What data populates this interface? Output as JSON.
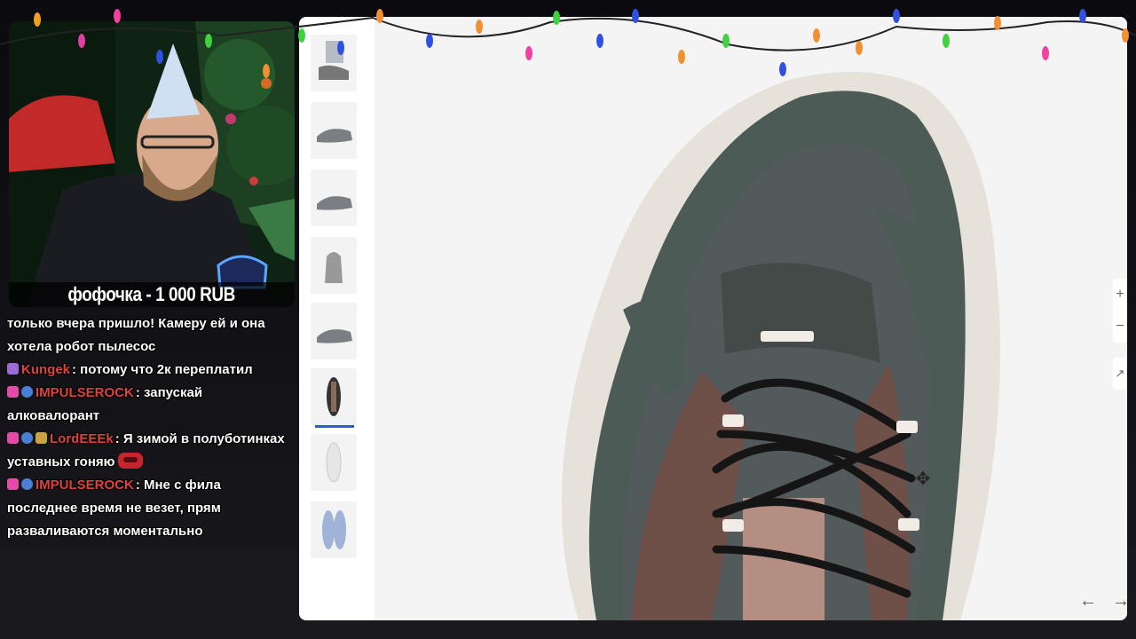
{
  "webcam": {
    "donation": "фофочка - 1 000 RUB"
  },
  "chat": {
    "messages": [
      {
        "user": "",
        "user_color": "#ffffff",
        "text": "только вчера пришло! Камеру ей и она хотела робот пылесос",
        "badges": []
      },
      {
        "user": "Kungek",
        "user_color": "#e0423b",
        "text": ": потому что 2к переплатил",
        "badges": [
          "purple"
        ]
      },
      {
        "user": "IMPULSEROCK",
        "user_color": "#e0423b",
        "text": ": запускай алковалорант",
        "badges": [
          "pink",
          "blue"
        ]
      },
      {
        "user": "LordEEEk",
        "user_color": "#e0423b",
        "text": ": Я зимой в полуботинках уставных гоняю",
        "badges": [
          "pink",
          "blue",
          "gold"
        ],
        "emote": "emote"
      },
      {
        "user": "IMPULSEROCK",
        "user_color": "#e0423b",
        "text": ": Мне с фила последнее время не везет, прям разваливаются моментально",
        "badges": [
          "pink",
          "blue"
        ]
      }
    ]
  },
  "viewer": {
    "thumbnails": [
      {
        "label": "sneaker-on-foot-view",
        "active": false
      },
      {
        "label": "sneaker-side-view",
        "active": false
      },
      {
        "label": "sneaker-angled-view",
        "active": false
      },
      {
        "label": "sneaker-back-view",
        "active": false
      },
      {
        "label": "sneaker-outer-side-view",
        "active": false
      },
      {
        "label": "sneaker-top-view",
        "active": true
      },
      {
        "label": "sneaker-sole-view",
        "active": false
      },
      {
        "label": "insole-view",
        "active": false
      }
    ],
    "zoom_in": "+",
    "zoom_out": "−",
    "expand": "↗",
    "prev": "←",
    "next": "→",
    "cursor": "✥"
  },
  "colors": {
    "accent": "#2f5bd3",
    "shoe_upper": "#4c5b55",
    "shoe_suede": "#6f5048",
    "shoe_sole": "#e6e2da",
    "username": "#e0423b"
  }
}
